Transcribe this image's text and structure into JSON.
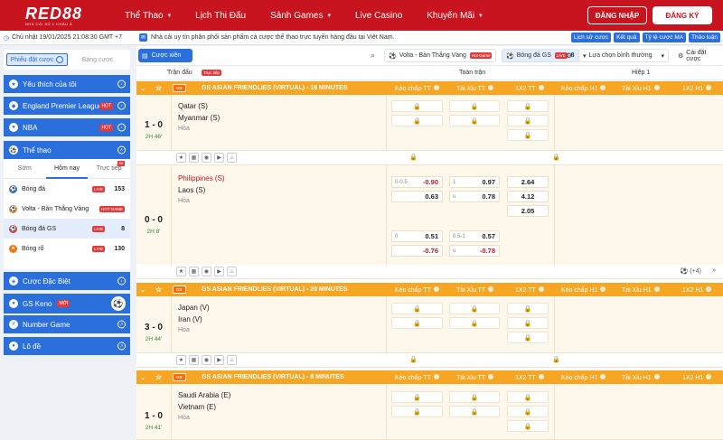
{
  "brand": {
    "logo_text": "RED88",
    "tagline": "NHÀ CÁI SỐ 1 CHÂU Á"
  },
  "nav": [
    {
      "label": "Thể Thao",
      "dropdown": true
    },
    {
      "label": "Lịch Thi Đấu",
      "dropdown": false
    },
    {
      "label": "Sảnh Games",
      "dropdown": true
    },
    {
      "label": "Live Casino",
      "dropdown": false
    },
    {
      "label": "Khuyến Mãi",
      "dropdown": true
    }
  ],
  "auth": {
    "login": "ĐĂNG NHẬP",
    "register": "ĐĂNG KÝ"
  },
  "infobar": {
    "datetime": "Chủ nhật 19/01/2025 21:08:30 GMT +7",
    "notice": "Nhà cái uy tín phân phối sản phẩm cá cược thể thao trực tuyến hàng đầu tại Việt Nam.",
    "tools": [
      "Lịch sử cược",
      "Kết quả",
      "Tỷ lệ cược MA",
      "Thảo luận"
    ]
  },
  "sidebar": {
    "betslip_tabs": [
      "Phiếu đặt cược",
      "Bảng cược"
    ],
    "favorites": "Yêu thích của tôi",
    "leagues": [
      {
        "label": "England Premier League",
        "badge": "HOT"
      },
      {
        "label": "NBA",
        "badge": "HOT"
      }
    ],
    "sports_header": "Thể thao",
    "sport_tabs": [
      "Sớm",
      "Hôm nay",
      "Trực tiếp"
    ],
    "sport_tab_live_badge": "99",
    "sports": [
      {
        "label": "Bóng đá",
        "badge": "LIVE",
        "count": "153",
        "color": "#2a6fdb"
      },
      {
        "label": "Volta - Bàn Thắng Vàng",
        "badge": "HOT GAME",
        "count": "",
        "color": "#e08a2a"
      },
      {
        "label": "Bóng đá GS",
        "badge": "LIVE",
        "count": "8",
        "color": "#e23b3b"
      },
      {
        "label": "Bóng rổ",
        "badge": "LIVE",
        "count": "130",
        "color": "#f07a1a"
      }
    ],
    "specials": "Cược Đặc Biệt",
    "keno": {
      "label": "GS Keno",
      "badge": "MỚI"
    },
    "number_game": "Number Game",
    "lode": "Lô đề"
  },
  "filters": {
    "parlay": "Cược xiên",
    "volta": {
      "label": "Volta - Bàn Thắng Vàng",
      "tag": "Hot Game"
    },
    "gs": {
      "label": "Bóng đá GS",
      "tag": "LIVE",
      "count": "8"
    },
    "sort": "Lựa chọn bình thường",
    "settings": "Cài đặt cược"
  },
  "columns": {
    "match": "Trận đấu",
    "live": "Trực tiếp",
    "full": "Toàn trận",
    "half": "Hiệp 1",
    "hcap_ft": "Kèo chấp TT",
    "ou_ft": "Tài Xỉu TT",
    "x12_ft": "1X2 TT",
    "hcap_h1": "Kèo chấp H1",
    "ou_h1": "Tài Xỉu H1",
    "x12_h1": "1X2 H1"
  },
  "leagues": [
    {
      "name": "GS ASIAN FRIENDLIES (VIRTUAL) - 16 MINUTES",
      "match": {
        "score": "1 - 0",
        "time": "2H 46'",
        "home": "Qatar (S)",
        "away": "Myanmar (S)",
        "draw": "Hòa"
      }
    },
    {
      "name": "",
      "match": {
        "score": "0 - 0",
        "time": "2H 8'",
        "home": "Philippines (S)",
        "away": "Laos (S)",
        "draw": "Hòa",
        "hcap_ft": [
          {
            "line": "0-0.5",
            "value": "-0.90",
            "red": true
          },
          {
            "line": "",
            "value": "0.63",
            "red": false
          }
        ],
        "ou_ft": [
          {
            "line": "1",
            "value": "0.97",
            "red": false
          },
          {
            "line": "u",
            "value": "0.78",
            "red": false
          }
        ],
        "x12_ft": [
          "2.64",
          "4.12",
          "2.05"
        ],
        "hcap_ft2": [
          {
            "line": "0",
            "value": "0.51",
            "red": false
          },
          {
            "line": "",
            "value": "-0.76",
            "red": true
          }
        ],
        "ou_ft2": [
          {
            "line": "0.5-1",
            "value": "0.57",
            "red": false
          },
          {
            "line": "u",
            "value": "-0.78",
            "red": true
          }
        ],
        "more": "(+4)"
      }
    },
    {
      "name": "GS ASIAN FRIENDLIES (VIRTUAL) - 20 MINUTES",
      "match": {
        "score": "3 - 0",
        "time": "2H 44'",
        "home": "Japan (V)",
        "away": "Iran (V)",
        "draw": "Hòa"
      }
    },
    {
      "name": "GS ASIAN FRIENDLIES (VIRTUAL) - 8 MINUTES",
      "match": {
        "score": "1 - 0",
        "time": "2H 41'",
        "home": "Saudi Arabia (E)",
        "away": "Vietnam (E)",
        "draw": "Hòa"
      }
    }
  ]
}
